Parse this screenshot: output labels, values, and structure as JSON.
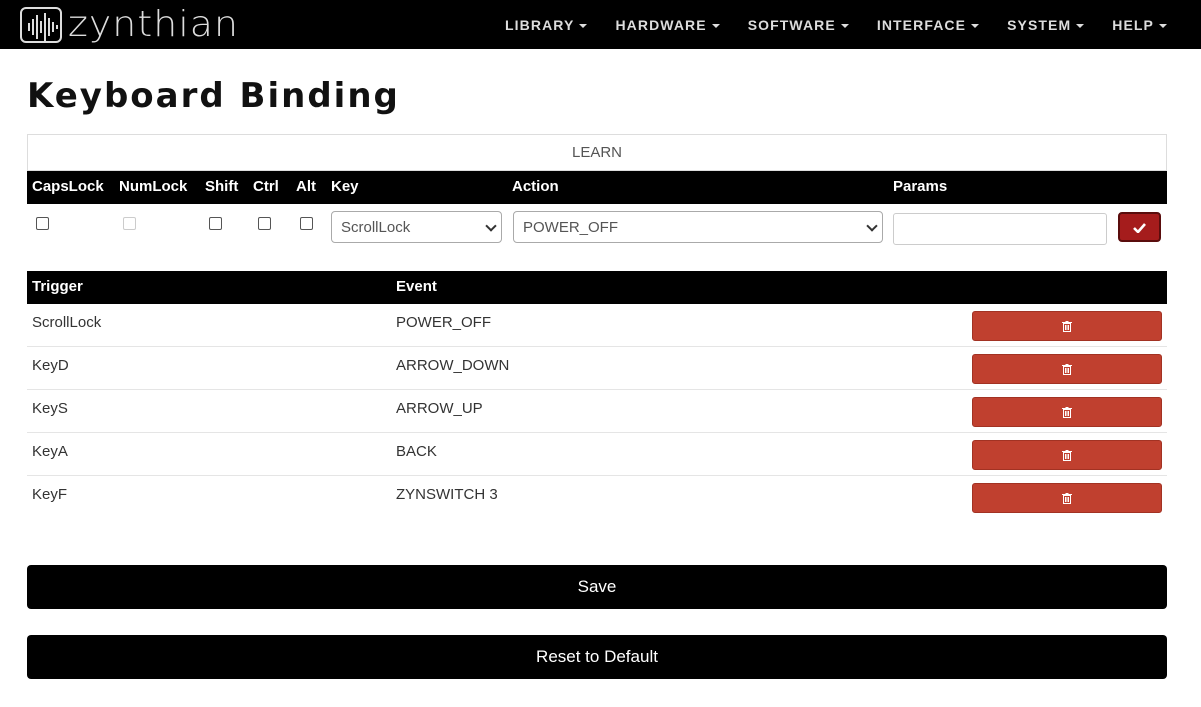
{
  "brand": {
    "name": "zynthian"
  },
  "nav": {
    "items": [
      {
        "label": "LIBRARY"
      },
      {
        "label": "HARDWARE"
      },
      {
        "label": "SOFTWARE"
      },
      {
        "label": "INTERFACE"
      },
      {
        "label": "SYSTEM"
      },
      {
        "label": "HELP"
      }
    ]
  },
  "page": {
    "title": "Keyboard Binding"
  },
  "learn": {
    "label": "LEARN"
  },
  "binding": {
    "headers": {
      "capslock": "CapsLock",
      "numlock": "NumLock",
      "shift": "Shift",
      "ctrl": "Ctrl",
      "alt": "Alt",
      "key": "Key",
      "action": "Action",
      "params": "Params"
    },
    "key_value": "ScrollLock",
    "action_value": "POWER_OFF",
    "params_value": ""
  },
  "events": {
    "headers": {
      "trigger": "Trigger",
      "event": "Event"
    },
    "rows": [
      {
        "trigger": "ScrollLock",
        "event": "POWER_OFF"
      },
      {
        "trigger": "KeyD",
        "event": "ARROW_DOWN"
      },
      {
        "trigger": "KeyS",
        "event": "ARROW_UP"
      },
      {
        "trigger": "KeyA",
        "event": "BACK"
      },
      {
        "trigger": "KeyF",
        "event": "ZYNSWITCH 3"
      }
    ]
  },
  "buttons": {
    "save": "Save",
    "reset": "Reset to Default"
  },
  "colors": {
    "navbar": "#000000",
    "accent_red": "#a51c1c",
    "delete_red": "#c0402f"
  }
}
